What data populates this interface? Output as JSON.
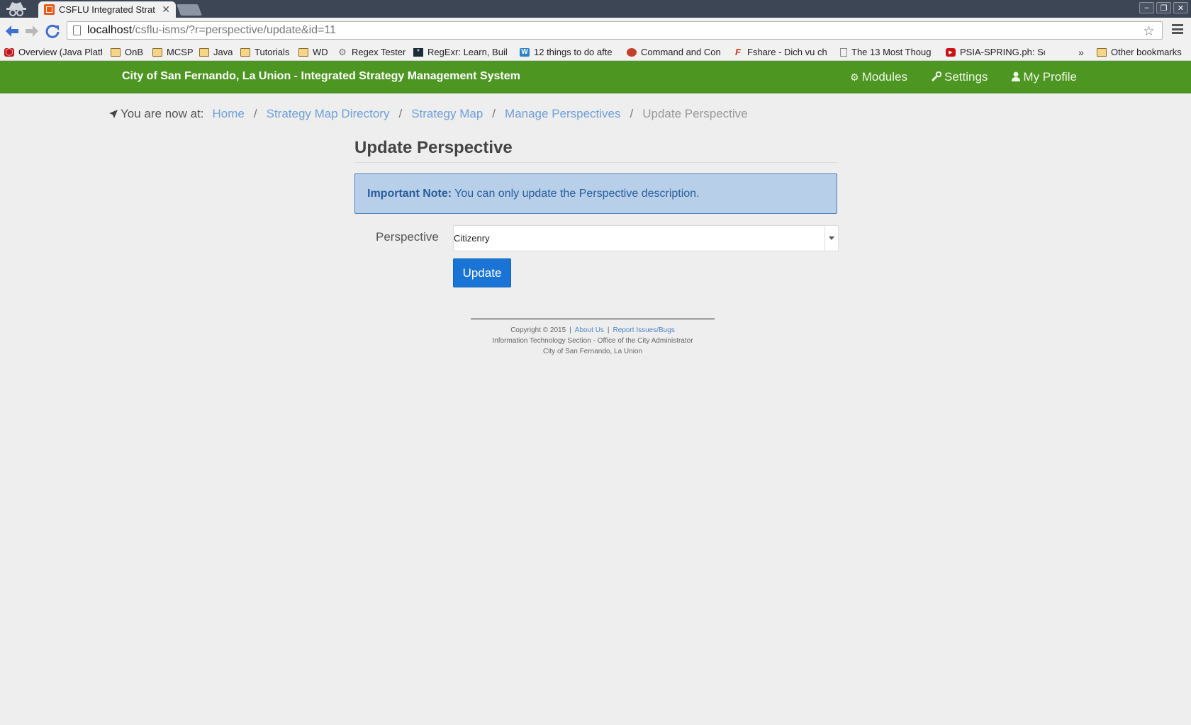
{
  "browser": {
    "tab_title": "CSFLU Integrated Strat",
    "url_host": "localhost",
    "url_path": "/csflu-isms/?r=perspective/update&id=11",
    "bookmarks": [
      {
        "label": "Overview (Java Platf",
        "icon": "oracle-icon"
      },
      {
        "label": "OnB",
        "icon": "folder-icon"
      },
      {
        "label": "MCSP",
        "icon": "folder-icon"
      },
      {
        "label": "Java",
        "icon": "folder-icon"
      },
      {
        "label": "Tutorials",
        "icon": "folder-icon"
      },
      {
        "label": "WD",
        "icon": "folder-icon"
      },
      {
        "label": "Regex Tester",
        "icon": "gear-icon"
      },
      {
        "label": "RegExr: Learn, Buil",
        "icon": "regexr-icon"
      },
      {
        "label": "12 things to do afte",
        "icon": "wordpress-icon"
      },
      {
        "label": "Command and Con",
        "icon": "globe-icon"
      },
      {
        "label": "Fshare - Dich vu ch",
        "icon": "fshare-icon"
      },
      {
        "label": "The 13 Most Thoug",
        "icon": "page-icon"
      },
      {
        "label": "PSIA-SPRING.ph: Sc",
        "icon": "youtube-icon"
      }
    ],
    "bookmarks_more": "»",
    "other_bookmarks": "Other bookmarks"
  },
  "app": {
    "brand": "City of San Fernando, La Union - Integrated Strategy Management System",
    "nav": {
      "modules": "Modules",
      "settings": "Settings",
      "profile": "My Profile"
    },
    "breadcrumb": {
      "prefix": "You are now at:",
      "items": [
        "Home",
        "Strategy Map Directory",
        "Strategy Map",
        "Manage Perspectives"
      ],
      "current": "Update Perspective",
      "separator": "/"
    },
    "page_title": "Update Perspective",
    "alert": {
      "strong": "Important Note:",
      "text": "You can only update the Perspective description."
    },
    "form": {
      "perspective_label": "Perspective",
      "perspective_value": "Citizenry",
      "submit_label": "Update"
    },
    "footer": {
      "copyright": "Copyright © 2015",
      "about": "About Us",
      "report": "Report Issues/Bugs",
      "sep": "|",
      "line2": "Information Technology Section - Office of the City Administrator",
      "line3": "City of San Fernando, La Union"
    }
  },
  "colors": {
    "navbar": "#4d9622",
    "link": "#6f9fd8",
    "alert_bg": "#b7cfe9",
    "button": "#1a74d6"
  }
}
